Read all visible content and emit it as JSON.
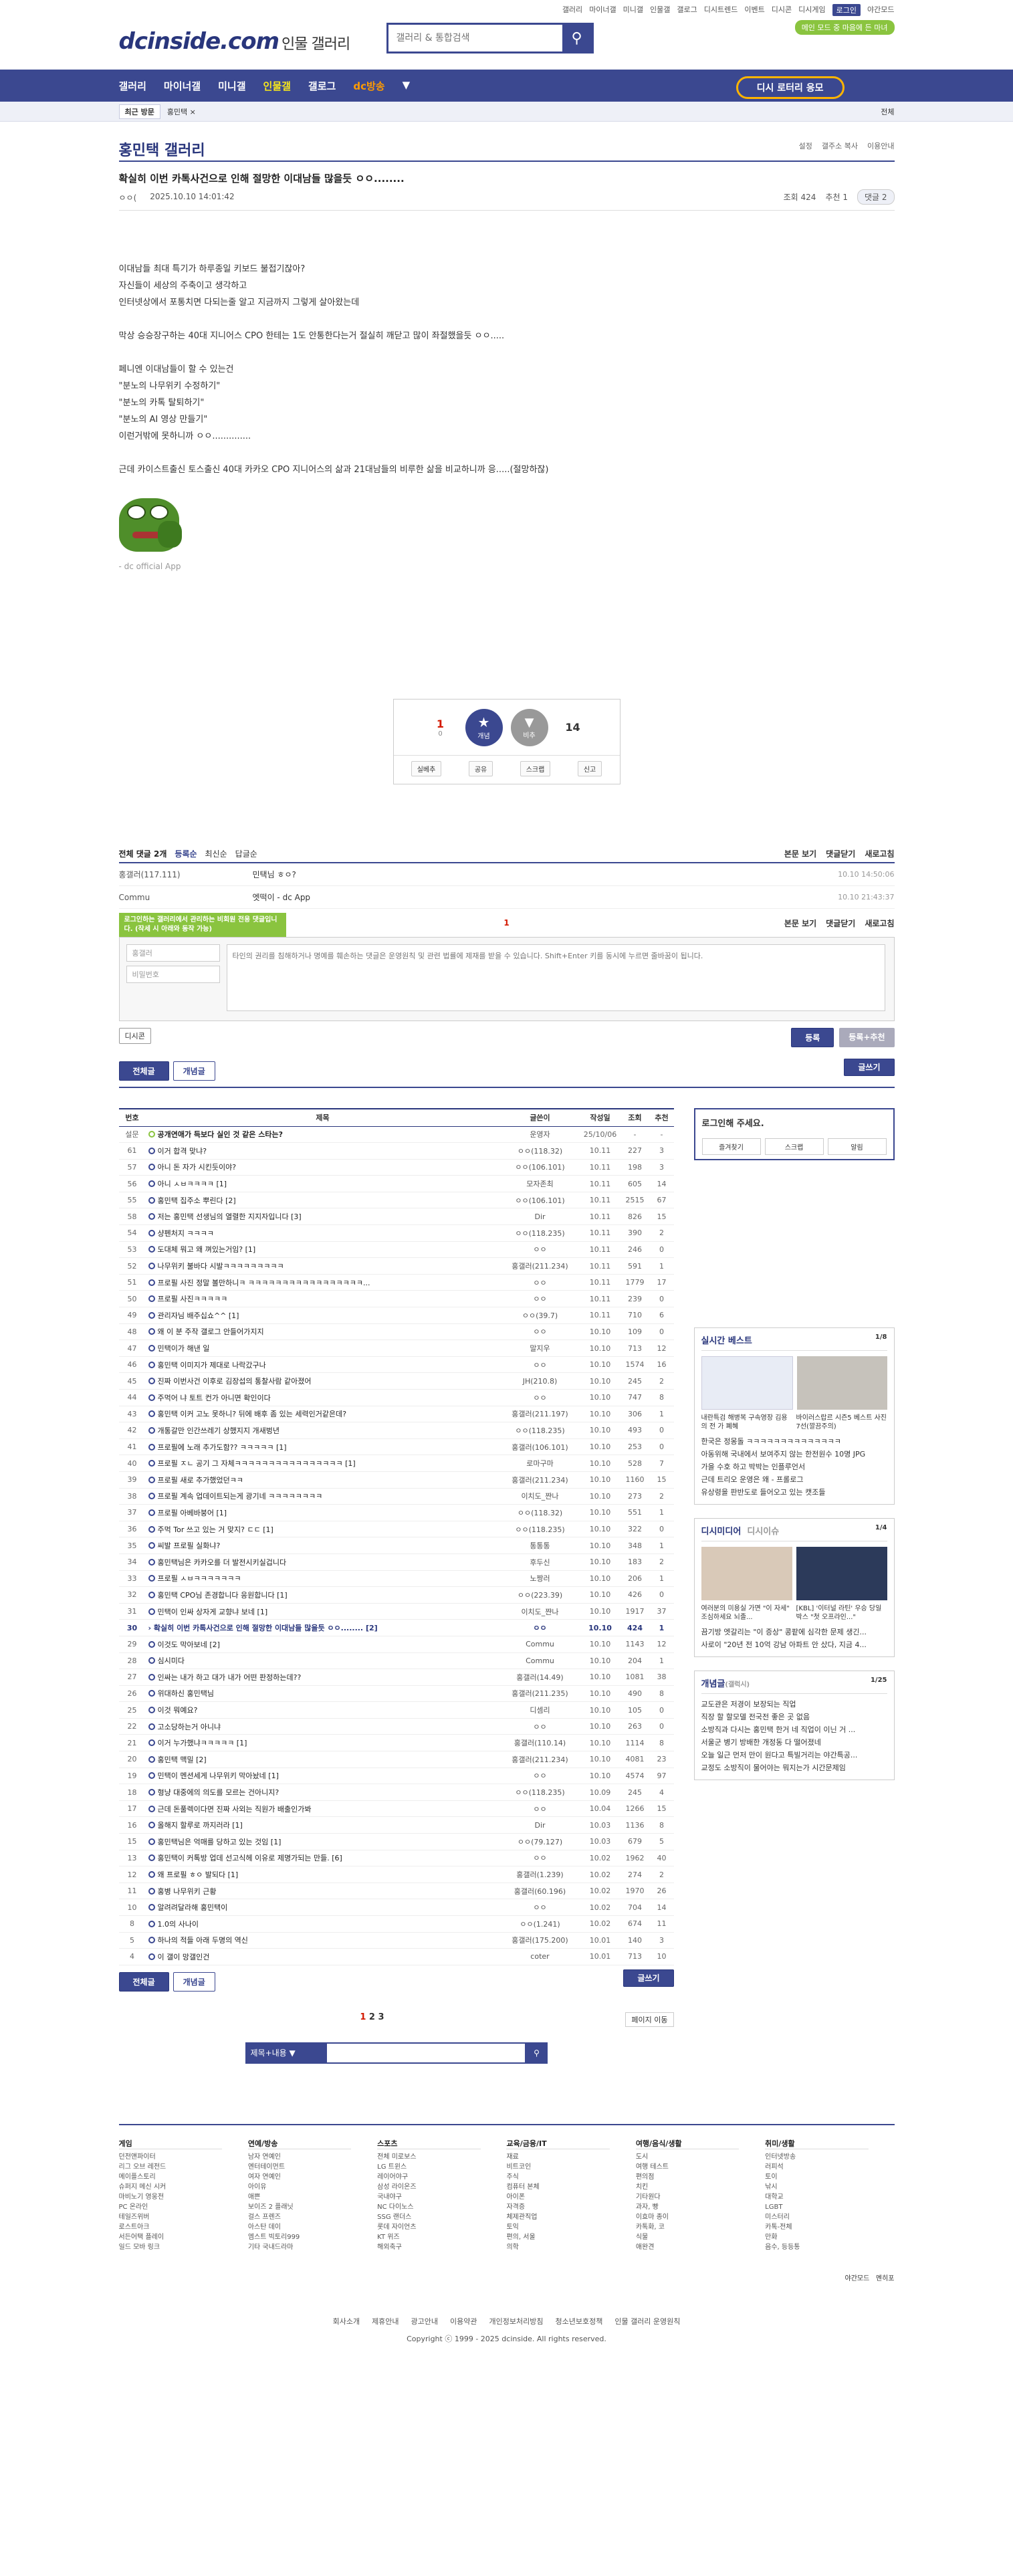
{
  "util_links": [
    "갤러리",
    "마이너갤",
    "미니갤",
    "인물갤",
    "갤로그",
    "디시트렌드",
    "이벤트",
    "디시콘",
    "디시게임",
    "로그인",
    "야간모드"
  ],
  "promo_badge": "메인 모드 중 마음에 든 마녀",
  "logo": {
    "main": "dcinside.com",
    "sub": "인물 갤러리"
  },
  "search": {
    "placeholder": "갤러리 & 통합검색"
  },
  "gnb": {
    "items": [
      "갤러리",
      "마이너갤",
      "미니갤",
      "인물갤",
      "갤로그",
      "dc방송"
    ],
    "promo": "디시 로터리 응모"
  },
  "subbar": {
    "recent": "최근 방문",
    "crumb": "홍민택 ×",
    "all": "전체"
  },
  "gallery": {
    "title": "홍민택 갤러리",
    "tools": [
      "설정",
      "갤주소 복사",
      "이용안내"
    ]
  },
  "post": {
    "subject": "확실히 이번 카톡사건으로 인해 절망한 이대남들 많을듯 ㅇㅇ........",
    "writer": "ㅇㅇ(",
    "date": "2025.10.10 14:01:42",
    "views": "조회 424",
    "reco": "추천 1",
    "comments": "댓글 2",
    "body": [
      "",
      "이대남들 최대 특기가 하루종일 키보드 불접기잖아?",
      "자신들이 세상의 주축이고 생각하고",
      "인터넷상에서 포통치면 다되는줄 알고 지금까지 그렇게 살아왔는데",
      "",
      "막상 승승장구하는 40대 지니어스 CPO 한테는 1도 안통한다는거 절실히 깨닫고 많이 좌절했을듯 ㅇㅇ.....",
      "",
      "페니엔 이대남들이 할 수 있는건",
      "\"분노의 나무위키 수정하기\"",
      "\"분노의 카톡 탈퇴하기\"",
      "\"분노의 AI 영상 만들기\"",
      "이런거밖에 못하니까 ㅇㅇ..............",
      "",
      "근데 카이스트출신 토스출신 40대 카카오 CPO 지니어스의 삶과 21대남들의 비루한 삶을 비교하니까 응.....(절망하잖)"
    ],
    "caption": "- dc official App"
  },
  "reco": {
    "up": "1",
    "up_sub": "0",
    "up_label": "개념",
    "down": "14",
    "down_label": "비추",
    "actions": [
      "실베추",
      "공유",
      "스크랩",
      "신고"
    ]
  },
  "comments": {
    "header": {
      "count": "전체 댓글 2개",
      "sorts": [
        "등록순",
        "최신순",
        "답글순"
      ],
      "right": [
        "본문 보기",
        "댓글닫기",
        "새로고침"
      ]
    },
    "rows": [
      {
        "nick": "홍갤러(117.111)",
        "text": "민택님 ㅎㅇ?",
        "date": "10.10 14:50:06"
      },
      {
        "nick": "Commu",
        "text": "엣떡이 - dc App",
        "date": "10.10 21:43:37"
      }
    ],
    "page": "1",
    "tip": "로그인하는 갤러리에서 관리하는 비회원 전용 댓글입니다. (작세 시 아래와 동작 가능)",
    "id_placeholder": "홍갤러",
    "pw_placeholder": "비밀번호",
    "text_placeholder": "타인의 권리를 침해하거나 명예를 훼손하는 댓글은 운영원칙 및 관련 법률에 제재를 받을 수 있습니다. Shift+Enter 키를 동시에 누르면 줄바꿈이 됩니다.",
    "dccon": "디시콘",
    "submit": "등록",
    "submit_reco": "등록+추천"
  },
  "list_btns": {
    "all": "전체글",
    "concept": "개념글",
    "write": "글쓰기"
  },
  "board": {
    "headers": [
      "번호",
      "제목",
      "글쓴이",
      "작성일",
      "조회",
      "추천"
    ],
    "rows": [
      {
        "num": "설문",
        "title": "공개연애가 득보다 실인 것 같은 스타는?",
        "writer": "운영자",
        "date": "25/10/06",
        "cnt": "-",
        "rec": "-",
        "notice": true
      },
      {
        "num": "61",
        "title": "이거 합격 맞냐?",
        "writer": "ㅇㅇ(118.32)",
        "date": "10.11",
        "cnt": "227",
        "rec": "3"
      },
      {
        "num": "57",
        "title": "아니 돈 자가 시킨듯이야?",
        "writer": "ㅇㅇ(106.101)",
        "date": "10.11",
        "cnt": "198",
        "rec": "3"
      },
      {
        "num": "56",
        "title": "아니 ㅅㅂㅋㅋㅋㅋ [1]",
        "writer": "모자존최",
        "date": "10.11",
        "cnt": "605",
        "rec": "14"
      },
      {
        "num": "55",
        "title": "홍민택 집주소 뿌린다 [2]",
        "writer": "ㅇㅇ(106.101)",
        "date": "10.11",
        "cnt": "2515",
        "rec": "67"
      },
      {
        "num": "58",
        "title": "저는 홍민택 선생님의 열렬한 지지자입니다 [3]",
        "writer": "Dir",
        "date": "10.11",
        "cnt": "826",
        "rec": "15"
      },
      {
        "num": "54",
        "title": "샹펜처지 ㅋㅋㅋㅋ",
        "writer": "ㅇㅇ(118.235)",
        "date": "10.11",
        "cnt": "390",
        "rec": "2"
      },
      {
        "num": "53",
        "title": "도대체 뭐고 왜 껴있는거임? [1]",
        "writer": "ㅇㅇ",
        "date": "10.11",
        "cnt": "246",
        "rec": "0"
      },
      {
        "num": "52",
        "title": "나무위키 불바다 시발ㅋㅋㅋㅋㅋㅋㅋㅋㅋ",
        "writer": "홍갤러(211.234)",
        "date": "10.11",
        "cnt": "591",
        "rec": "1"
      },
      {
        "num": "51",
        "title": "프로필 사진 정말 볼만하니ㅋ ㅋㅋㅋㅋㅋㅋㅋㅋㅋㅋㅋㅋㅋㅋㅋㅋㅋ...",
        "writer": "ㅇㅇ",
        "date": "10.11",
        "cnt": "1779",
        "rec": "17"
      },
      {
        "num": "50",
        "title": "프로필 사진ㅋㅋㅋㅋㅋ",
        "writer": "ㅇㅇ",
        "date": "10.11",
        "cnt": "239",
        "rec": "0"
      },
      {
        "num": "49",
        "title": "관리자님 배주십쇼^^ [1]",
        "writer": "ㅇㅇ(39.7)",
        "date": "10.11",
        "cnt": "710",
        "rec": "6"
      },
      {
        "num": "48",
        "title": "왜 이 분 주작 갤로그 안들어가지지",
        "writer": "ㅇㅇ",
        "date": "10.10",
        "cnt": "109",
        "rec": "0"
      },
      {
        "num": "47",
        "title": "민택이가 해낸 일",
        "writer": "말지우",
        "date": "10.10",
        "cnt": "713",
        "rec": "12"
      },
      {
        "num": "46",
        "title": "홍민택 이미지가 제대로 나락갔구나",
        "writer": "ㅇㅇ",
        "date": "10.10",
        "cnt": "1574",
        "rec": "16"
      },
      {
        "num": "45",
        "title": "진짜 이번사건 이후로 김장섭의 통찰사람 같아졌어",
        "writer": "JH(210.8)",
        "date": "10.10",
        "cnt": "245",
        "rec": "2"
      },
      {
        "num": "44",
        "title": "주먹어 냐 토트 컨가 아니면 확인이다",
        "writer": "ㅇㅇ",
        "date": "10.10",
        "cnt": "747",
        "rec": "8"
      },
      {
        "num": "43",
        "title": "홍민택 이커 고노 못하니? 뒤에 배후 좀 있는 세력인거같은데?",
        "writer": "홍갤러(211.197)",
        "date": "10.10",
        "cnt": "306",
        "rec": "1"
      },
      {
        "num": "42",
        "title": "개통갈만 인간쓰레기 상했지지 개새벙년",
        "writer": "ㅇㅇ(118.235)",
        "date": "10.10",
        "cnt": "493",
        "rec": "0"
      },
      {
        "num": "41",
        "title": "프로필에 노래 추가도함?? ㅋㅋㅋㅋㅋ [1]",
        "writer": "홍갤러(106.101)",
        "date": "10.10",
        "cnt": "253",
        "rec": "0"
      },
      {
        "num": "40",
        "title": "프로필 ㅈㄴ 공기 그 자체ㅋㅋㅋㅋㅋㅋㅋㅋㅋㅋㅋㅋㅋㅋㅋㅋ [1]",
        "writer": "로마구마",
        "date": "10.10",
        "cnt": "528",
        "rec": "7"
      },
      {
        "num": "39",
        "title": "프로필 새로 추가했었던ㅋㅋ",
        "writer": "홍갤러(211.234)",
        "date": "10.10",
        "cnt": "1160",
        "rec": "15"
      },
      {
        "num": "38",
        "title": "프로필 계속 업데이트되는게 광기네 ㅋㅋㅋㅋㅋㅋㅋㅋ",
        "writer": "이치도_쨘나",
        "date": "10.10",
        "cnt": "273",
        "rec": "2"
      },
      {
        "num": "37",
        "title": "프로필 아베바붕어 [1]",
        "writer": "ㅇㅇ(118.32)",
        "date": "10.10",
        "cnt": "551",
        "rec": "1"
      },
      {
        "num": "36",
        "title": "주먹 Tor 쓰고 있는 거 맞지? ㄷㄷ [1]",
        "writer": "ㅇㅇ(118.235)",
        "date": "10.10",
        "cnt": "322",
        "rec": "0"
      },
      {
        "num": "35",
        "title": "씨발 프로필 실화냐?",
        "writer": "통통통",
        "date": "10.10",
        "cnt": "348",
        "rec": "1"
      },
      {
        "num": "34",
        "title": "홍민택님은 카카오를 더 발전시키실겁니다",
        "writer": "후두신",
        "date": "10.10",
        "cnt": "183",
        "rec": "2"
      },
      {
        "num": "33",
        "title": "프로필 ㅅㅂㅋㅋㅋㅋㅋㅋㅋ",
        "writer": "노짱러",
        "date": "10.10",
        "cnt": "206",
        "rec": "1"
      },
      {
        "num": "32",
        "title": "홍민택 CPO님 존경합니다 응원합니다 [1]",
        "writer": "ㅇㅇ(223.39)",
        "date": "10.10",
        "cnt": "426",
        "rec": "0"
      },
      {
        "num": "31",
        "title": "민택이 인싸 상자게 교향냐 보네 [1]",
        "writer": "이치도_쨘나",
        "date": "10.10",
        "cnt": "1917",
        "rec": "37"
      },
      {
        "num": "30",
        "title": "확실히 이번 카톡사건으로 인해 절망한 이대남들 많을듯 ㅇㅇ........ [2]",
        "writer": "ㅇㅇ",
        "date": "10.10",
        "cnt": "424",
        "rec": "1",
        "current": true
      },
      {
        "num": "29",
        "title": "이것도 막아보네 [2]",
        "writer": "Commu",
        "date": "10.10",
        "cnt": "1143",
        "rec": "12"
      },
      {
        "num": "28",
        "title": "심시미다",
        "writer": "Commu",
        "date": "10.10",
        "cnt": "204",
        "rec": "1"
      },
      {
        "num": "27",
        "title": "인싸는 내가 하고 대가 내가 어떤 판정하는데??",
        "writer": "홍갤러(14.49)",
        "date": "10.10",
        "cnt": "1081",
        "rec": "38"
      },
      {
        "num": "26",
        "title": "위대하신 홍민택님",
        "writer": "홍갤러(211.235)",
        "date": "10.10",
        "cnt": "490",
        "rec": "8"
      },
      {
        "num": "25",
        "title": "이것 뭐예요?",
        "writer": "디셈리",
        "date": "10.10",
        "cnt": "105",
        "rec": "0"
      },
      {
        "num": "22",
        "title": "고소당하는거 아니냐",
        "writer": "ㅇㅇ",
        "date": "10.10",
        "cnt": "263",
        "rec": "0"
      },
      {
        "num": "21",
        "title": "이거 누가했냐ㅋㅋㅋㅋㅋ [1]",
        "writer": "홍갤러(110.14)",
        "date": "10.10",
        "cnt": "1114",
        "rec": "8"
      },
      {
        "num": "20",
        "title": "홍민택 맥밀 [2]",
        "writer": "홍갤러(211.234)",
        "date": "10.10",
        "cnt": "4081",
        "rec": "23"
      },
      {
        "num": "19",
        "title": "민택이 멘션세게 나무위키 막아놨네 [1]",
        "writer": "ㅇㅇ",
        "date": "10.10",
        "cnt": "4574",
        "rec": "97"
      },
      {
        "num": "18",
        "title": "형냥 대중에의 의도를 모르는 건아니지?",
        "writer": "ㅇㅇ(118.235)",
        "date": "10.09",
        "cnt": "245",
        "rec": "4"
      },
      {
        "num": "17",
        "title": "근데 돈풀렉이다면 진짜 사외는 직원가 배출인가봐",
        "writer": "ㅇㅇ",
        "date": "10.04",
        "cnt": "1266",
        "rec": "15"
      },
      {
        "num": "16",
        "title": "올해지 할루로 까지러라 [1]",
        "writer": "Dir",
        "date": "10.03",
        "cnt": "1136",
        "rec": "8"
      },
      {
        "num": "15",
        "title": "홍민택님은 억매를 당하고 있는 것임 [1]",
        "writer": "ㅇㅇ(79.127)",
        "date": "10.03",
        "cnt": "679",
        "rec": "5"
      },
      {
        "num": "13",
        "title": "홍민택이 커톡방 업데 선고식헤 이유로 제명가되는 만들. [6]",
        "writer": "ㅇㅇ",
        "date": "10.02",
        "cnt": "1962",
        "rec": "40"
      },
      {
        "num": "12",
        "title": "왜 프로필 ㅎㅇ 발되다 [1]",
        "writer": "홍갤러(1.239)",
        "date": "10.02",
        "cnt": "274",
        "rec": "2"
      },
      {
        "num": "11",
        "title": "홍병 나무위키 근황",
        "writer": "홍갤러(60.196)",
        "date": "10.02",
        "cnt": "1970",
        "rec": "26"
      },
      {
        "num": "10",
        "title": "알려려달라해 홍민택이",
        "writer": "ㅇㅇ",
        "date": "10.02",
        "cnt": "704",
        "rec": "14"
      },
      {
        "num": "8",
        "title": "1.0의 사나이",
        "writer": "ㅇㅇ(1.241)",
        "date": "10.02",
        "cnt": "674",
        "rec": "11"
      },
      {
        "num": "5",
        "title": "하나의 적들 아래 두명의 역신",
        "writer": "홍갤러(175.200)",
        "date": "10.01",
        "cnt": "140",
        "rec": "3"
      },
      {
        "num": "4",
        "title": "이 갤이 망갤인건",
        "writer": "coter",
        "date": "10.01",
        "cnt": "713",
        "rec": "10"
      }
    ]
  },
  "side": {
    "login_title": "로그인해 주세요.",
    "login_btns": [
      "즐겨찾기",
      "스크랩",
      "알림"
    ],
    "best": {
      "title": "실시간 베스트",
      "page": "1/8",
      "caps": [
        "내란특검 해병복 구속영장 김용의 전 가 폐혜",
        "바이러스랍르 시즌5 베스트 사진 7선(깔끔주의)"
      ],
      "items": [
        "한국은 정몽돌 ㅋㅋㅋㅋㅋㅋㅋㅋㅋㅋㅋㅋㅋㅋ",
        "아동위해 국내에서 보여주지 않는 한전원수 10명 JPG",
        "가을 수호 하고 박박는 인플루언서",
        "근데 트리오 운영은 왜 - 프롤로그",
        "유상령을 판반도로 들어오고 있는 캣조들"
      ]
    },
    "media": {
      "title": "디시미디어",
      "title2": "디시이슈",
      "page": "1/4",
      "caps": [
        "여러분의 미용실 가면 \"이 자세\" 조심하세요 뇌졸...",
        "[KBL] '이터널 라틴' 우승 당일 박스 \"첫 오프라인...\""
      ],
      "items": [
        "끔기방 엣갈리는 \"이 증상\" 콩팥에 심각한 문제 생긴...",
        "사로이 \"20년 전 10억 강남 아파트 안 샀다, 지금 4..."
      ]
    },
    "concept": {
      "title": "개념글",
      "title_sub": "(갤럭시)",
      "page": "1/25",
      "items": [
        "교도관은 저경이 보장되는 직업",
        "직장 할 할모델 전국전 좋은 곳 없음",
        "소방직과 다시는 홍민택 한거 네 직업이 이닌 거 ...",
        "서울군 병기 방배한 개정동 다 떨어졌네",
        "오늘 일근 먼저 만이 원다고 특빌거리는 야간특공...",
        "교정도 소방직이 물어야는 뭐지는가 시간문제임"
      ]
    }
  },
  "paging": {
    "pages": [
      "1",
      "2",
      "3"
    ],
    "move": "페이지 이동"
  },
  "bottom_search": {
    "select": "제목+내용"
  },
  "footer": {
    "cols": [
      {
        "title": "게임",
        "items": [
          "던전앤파이터",
          "리그 오브 레전드",
          "메이플스토리",
          "슈퍼지 메신 시커",
          "마비노기 영웅전",
          "PC 온라인",
          "테일즈위버",
          "로스트아크",
          "서든어택 플레이",
          "일드 모바 링크"
        ]
      },
      {
        "title": "연예/방송",
        "items": [
          "남자 연예인",
          "엔터테이먼트",
          "여자 연예인",
          "아이유",
          "애쁜",
          "보이즈 2 플래닛",
          "걸스 프렌즈",
          "아스탄 데이",
          "엠스트 빅토리999",
          "기타 국내드라마"
        ]
      },
      {
        "title": "스포츠",
        "items": [
          "전체 미로보스",
          "LG 트윈스",
          "레이어야구",
          "삼성 라이온즈",
          "국내야구",
          "NC 다이노스",
          "SSG 랜더스",
          "롯데 자이언츠",
          "KT 위즈",
          "해외축구"
        ]
      },
      {
        "title": "교육/금융/IT",
        "items": [
          "재료",
          "비트코인",
          "주식",
          "컴퓨터 본체",
          "아이폰",
          "자격증",
          "체제관직업",
          "토익",
          "편의, 서울",
          "의학"
        ]
      },
      {
        "title": "여행/음식/생활",
        "items": [
          "도시",
          "여행 테스트",
          "편의점",
          "치킨",
          "기타원다",
          "과자, 빵",
          "이효마 종이",
          "카톡화, 코",
          "식물",
          "애완견"
        ]
      },
      {
        "title": "취미/생활",
        "items": [
          "인터넷방송",
          "러피석",
          "토이",
          "낚시",
          "대학교",
          "LGBT",
          "미스터리",
          "카톡-전체",
          "만화",
          "음수, 등등통"
        ]
      }
    ],
    "mode": [
      "야간모드",
      "멘히포"
    ],
    "links": [
      "회사소개",
      "제휴안내",
      "광고안내",
      "이용약관",
      "개인정보처리방침",
      "청소년보호정책",
      "인물 갤러리 운영원칙"
    ],
    "copyright": "Copyright ⓒ 1999 - 2025 dcinside. All rights reserved."
  },
  "colors": {
    "brand": "#3b4890",
    "accent_red": "#d31900",
    "green": "#8ac43f"
  }
}
